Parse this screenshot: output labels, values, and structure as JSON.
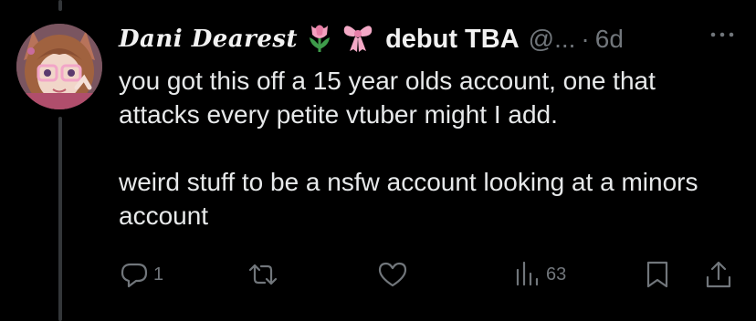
{
  "tweet": {
    "display_name": "Dani Dearest",
    "name_emojis": [
      "tulip-icon",
      "ribbon-icon"
    ],
    "name_suffix": "debut TBA",
    "handle": "@...",
    "separator": "·",
    "timestamp": "6d",
    "body_paragraphs": [
      "you got this off a 15 year olds account, one that attacks every petite vtuber might I add.",
      "weird stuff to be a nsfw account looking at a minors account"
    ]
  },
  "actions": {
    "reply_count": "1",
    "retweet_count": "",
    "like_count": "",
    "views_count": "63"
  },
  "colors": {
    "background": "#000000",
    "text": "#e7e9ea",
    "secondary": "#71767b",
    "thread_line": "#333639"
  }
}
